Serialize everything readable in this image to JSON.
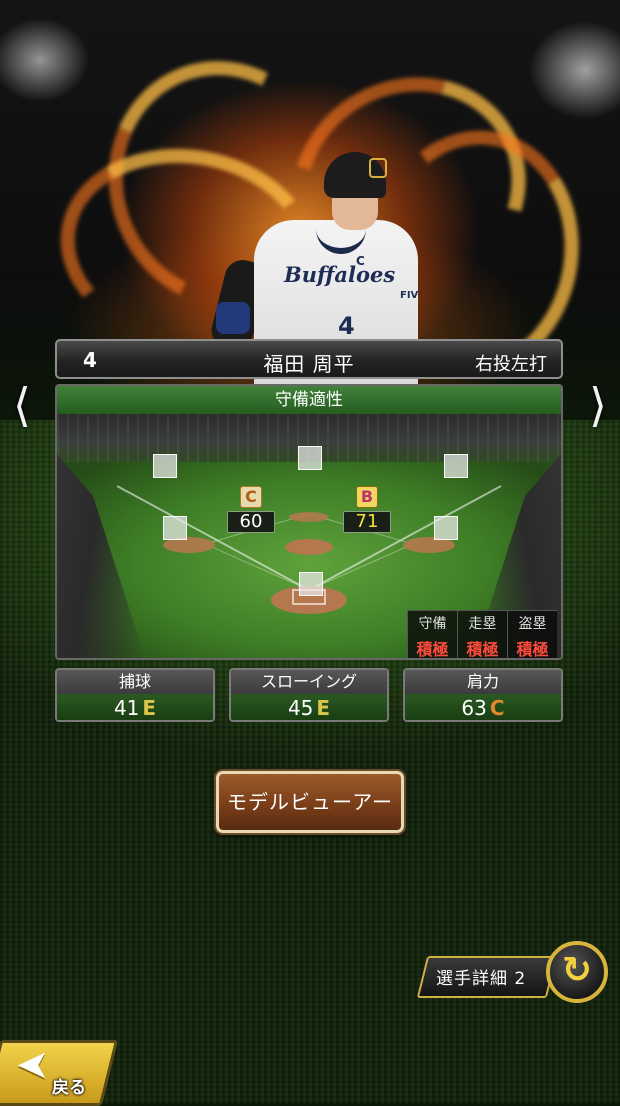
{
  "player": {
    "number": "4",
    "name": "福田 周平",
    "batting": "右投左打",
    "jersey_team": "Buffaloes",
    "jersey_mark": "C",
    "jersey_number": "4",
    "sleeve_mark": "FIV"
  },
  "defense": {
    "title": "守備適性",
    "positions": [
      {
        "grade": "C",
        "value": "60"
      },
      {
        "grade": "B",
        "value": "71"
      }
    ],
    "tactics": [
      {
        "label": "守備",
        "value": "積極"
      },
      {
        "label": "走塁",
        "value": "積極"
      },
      {
        "label": "盗塁",
        "value": "積極"
      }
    ]
  },
  "stats": [
    {
      "label": "捕球",
      "value": "41",
      "grade": "E",
      "grade_color": "#d9c64a"
    },
    {
      "label": "スローイング",
      "value": "45",
      "grade": "E",
      "grade_color": "#d9c64a"
    },
    {
      "label": "肩力",
      "value": "63",
      "grade": "C",
      "grade_color": "#e08a2a"
    }
  ],
  "buttons": {
    "model_viewer": "モデルビューアー",
    "detail": "選手詳細 2",
    "back": "戻る"
  },
  "icons": {
    "prev": "chevron-left",
    "next": "chevron-right",
    "cycle": "cycle-arrows",
    "back": "back-arrow"
  }
}
